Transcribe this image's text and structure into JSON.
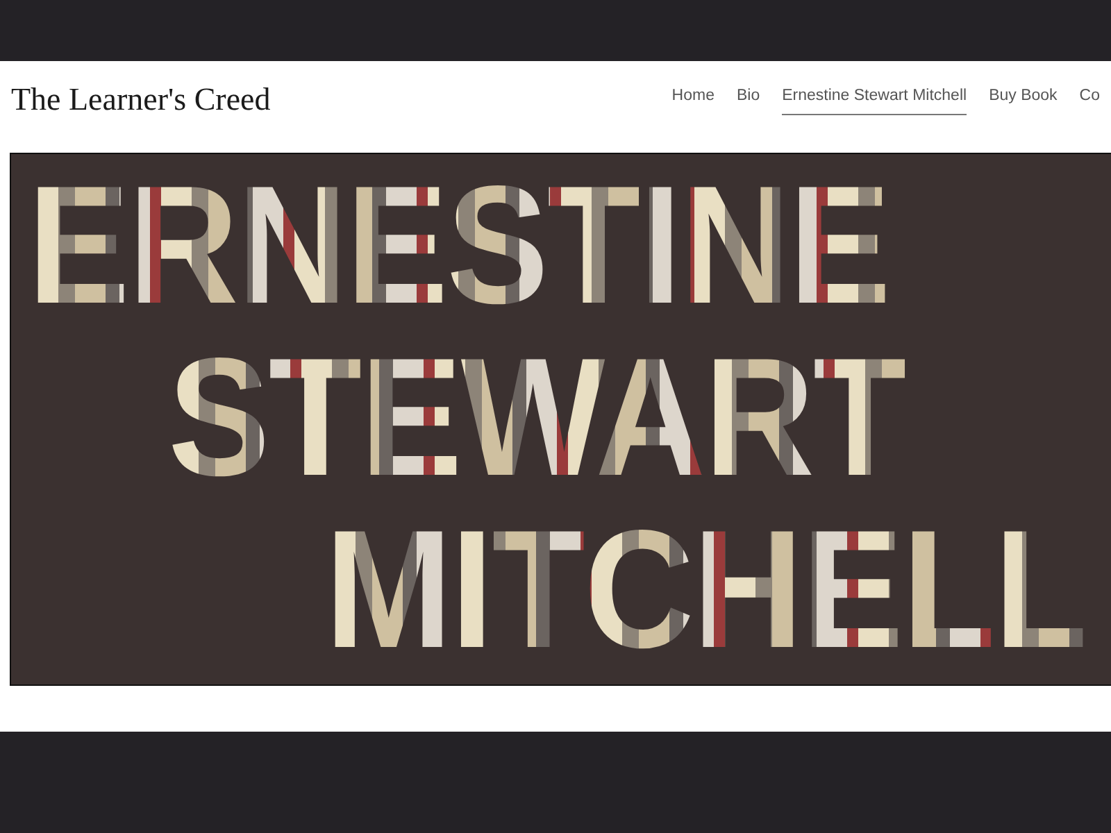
{
  "site": {
    "title": "The Learner's Creed"
  },
  "nav": [
    {
      "label": "Home",
      "selected": false
    },
    {
      "label": "Bio",
      "selected": false
    },
    {
      "label": "Ernestine Stewart Mitchell",
      "selected": true
    },
    {
      "label": "Buy Book",
      "selected": false
    },
    {
      "label": "Co",
      "selected": false
    }
  ],
  "banner": {
    "lines": [
      "ERNESTINE",
      "STEWART",
      "MITCHELL"
    ]
  }
}
